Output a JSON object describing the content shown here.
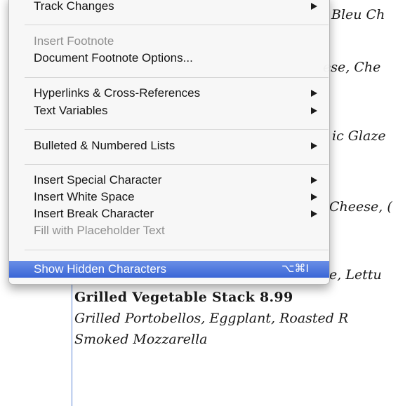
{
  "menu": {
    "items": [
      {
        "label": "Track Changes",
        "enabled": true,
        "submenu": true
      },
      {
        "label": "Insert Footnote",
        "enabled": false
      },
      {
        "label": "Document Footnote Options...",
        "enabled": true
      },
      {
        "label": "Hyperlinks & Cross-References",
        "enabled": true,
        "submenu": true
      },
      {
        "label": "Text Variables",
        "enabled": true,
        "submenu": true
      },
      {
        "label": "Bulleted & Numbered Lists",
        "enabled": true,
        "submenu": true
      },
      {
        "label": "Insert Special Character",
        "enabled": true,
        "submenu": true
      },
      {
        "label": "Insert White Space",
        "enabled": true,
        "submenu": true
      },
      {
        "label": "Insert Break Character",
        "enabled": true,
        "submenu": true
      },
      {
        "label": "Fill with Placeholder Text",
        "enabled": false
      },
      {
        "label": "Show Hidden Characters",
        "enabled": true,
        "highlighted": true,
        "shortcut": "⌥⌘I"
      }
    ]
  },
  "document": {
    "right_fragments": [
      "Bleu Ch",
      "ese, Che",
      "ic Glaze",
      "Cheese, (",
      "e, Lettu"
    ],
    "dish_title": "Grilled Vegetable Stack",
    "dish_price": "8.99",
    "dish_desc_line1": "Grilled Portobellos, Eggplant, Roasted R",
    "dish_desc_line2": "Smoked Mozzarella"
  },
  "colors": {
    "highlight": "#3a66d6",
    "disabled_text": "#8f8f8f",
    "margin_guide": "#5b86d6"
  }
}
